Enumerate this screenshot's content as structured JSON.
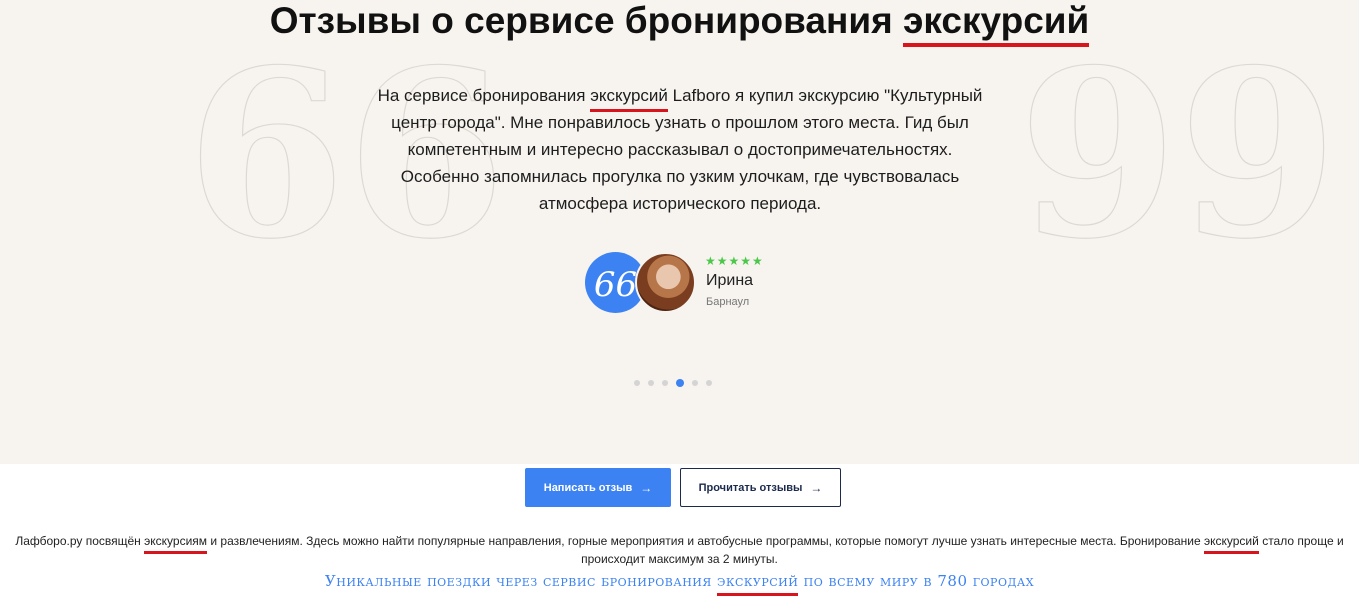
{
  "section": {
    "title_before": "Отзывы о сервисе бронирования",
    "title_highlight": "экскурсий"
  },
  "review": {
    "text_before": "На сервисе бронирования",
    "text_highlight": "экскурсий",
    "text_after": "Lafboro я купил экскурсию \"Культурный центр города\". Мне понравилось узнать о прошлом этого места. Гид был компетентным и интересно рассказывал о достопримечательностях. Особенно запомнилась прогулка по узким улочкам, где чувствовалась атмосфера исторического периода.",
    "rating": 5,
    "stars": "★★★★★",
    "author_name": "Ирина",
    "author_city": "Барнаул",
    "quote_glyph": "66",
    "open_quote": "66",
    "close_quote": "99"
  },
  "carousel": {
    "total_slides": 6,
    "active_slide": 4
  },
  "buttons": {
    "write_review": "Написать отзыв",
    "read_reviews": "Прочитать отзывы",
    "arrow": "→"
  },
  "footer": {
    "text_part1": "Лафборо.ру посвящён",
    "text_highlight1": "экскурсиям",
    "text_part2": "и развлечениям. Здесь можно найти популярные направления, горные мероприятия и автобусные программы, которые помогут лучше узнать интересные места. Бронирование",
    "text_highlight2": "экскурсий",
    "text_part3": "стало проще и происходит максимум за 2 минуты.",
    "tagline_before": "Уникальные поездки через сервис бронирования",
    "tagline_highlight": "экскурсий",
    "tagline_after": "по всему миру в 780 городах"
  },
  "colors": {
    "accent": "#3c82f2",
    "highlight_underline": "#d8141c",
    "stars": "#4cc74a",
    "section_bg": "#f7f4f0"
  }
}
